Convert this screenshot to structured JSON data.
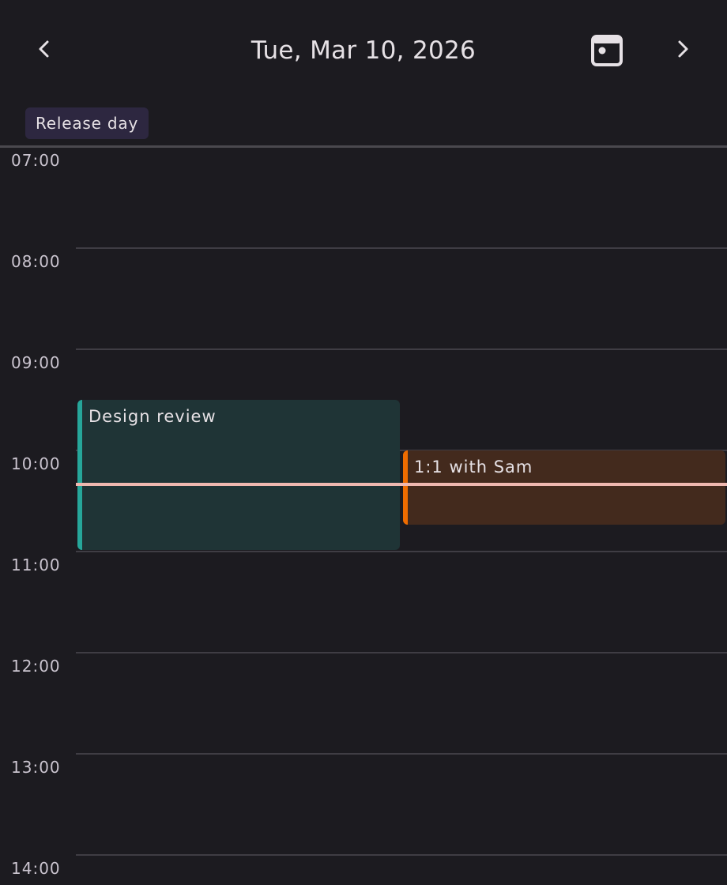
{
  "header": {
    "title": "Tue, Mar 10, 2026",
    "prev_icon": "chevron-left-icon",
    "today_icon": "calendar-today-icon",
    "next_icon": "chevron-right-icon"
  },
  "all_day": {
    "events": [
      {
        "title": "Release day",
        "color": "#2d2740"
      }
    ]
  },
  "timeline": {
    "hours": [
      "07:00",
      "08:00",
      "09:00",
      "10:00",
      "11:00",
      "12:00",
      "13:00",
      "14:00"
    ],
    "events": [
      {
        "title": "Design review",
        "start": "09:30",
        "end": "11:00",
        "accent": "#26a69a",
        "background": "#1f3436"
      },
      {
        "title": "1:1 with Sam",
        "start": "10:00",
        "end": "10:45",
        "accent": "#ef6c00",
        "background": "#432a1d"
      }
    ],
    "now": "10:20",
    "now_color": "#efb8b0"
  }
}
